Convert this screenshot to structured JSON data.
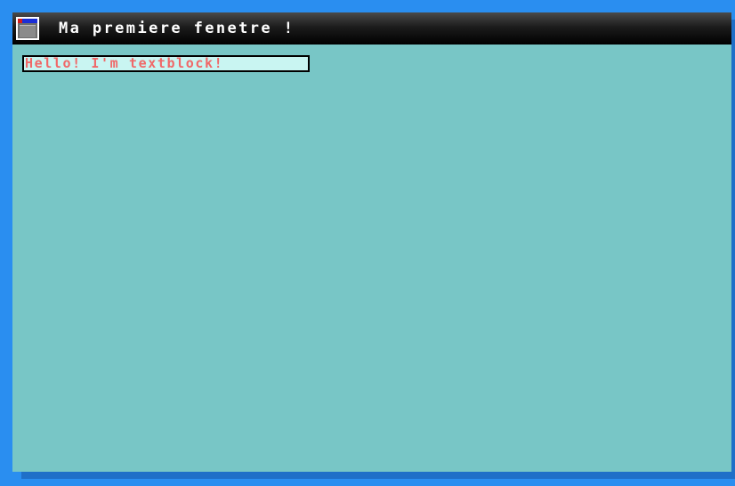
{
  "window": {
    "title": "Ma premiere fenetre !",
    "icon": "window-icon"
  },
  "content": {
    "textblock": "Hello! I'm textblock!"
  },
  "colors": {
    "desktop": "#2a8ef0",
    "client_area": "#78c6c6",
    "title_text": "#ffffff",
    "textblock_background": "#c9f5f2",
    "textblock_text": "#f06868"
  }
}
